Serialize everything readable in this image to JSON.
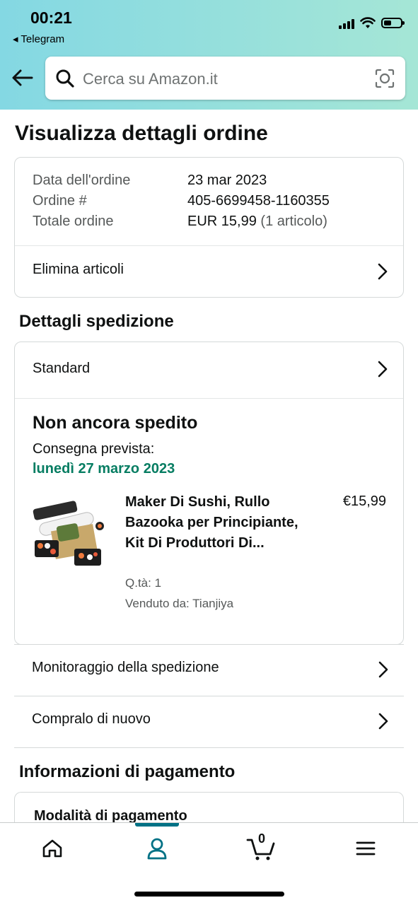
{
  "status_bar": {
    "time": "00:21",
    "back_app": "◂ Telegram"
  },
  "search": {
    "placeholder": "Cerca su Amazon.it"
  },
  "page": {
    "title": "Visualizza dettagli ordine"
  },
  "order_summary": {
    "date_label": "Data dell'ordine",
    "date_value": "23 mar 2023",
    "number_label": "Ordine #",
    "number_value": "405-6699458-1160355",
    "total_label": "Totale ordine",
    "total_value": "EUR 15,99",
    "total_items": "(1 articolo)",
    "delete_items": "Elimina articoli"
  },
  "shipping": {
    "section_title": "Dettagli spedizione",
    "method": "Standard",
    "status": "Non ancora spedito",
    "delivery_label": "Consegna prevista:",
    "delivery_date": "lunedì 27 marzo 2023",
    "product": {
      "name": "Maker Di Sushi, Rullo Bazooka per Principiante, Kit Di Produttori Di...",
      "price": "€15,99",
      "qty": "Q.tà: 1",
      "seller": "Venduto da: Tianjiya"
    }
  },
  "actions": {
    "track": "Monitoraggio della spedizione",
    "buy_again": "Compralo di nuovo"
  },
  "payment": {
    "section_title": "Informazioni di pagamento",
    "method_label": "Modalità di pagamento"
  },
  "tabbar": {
    "cart_count": "0",
    "active_tab": "account"
  },
  "colors": {
    "accent": "#007185",
    "delivery_green": "#067d62",
    "header_gradient_start": "#84d8e3",
    "header_gradient_end": "#a5e6d6"
  },
  "icons": [
    "back-arrow-icon",
    "search-icon",
    "camera-icon",
    "chevron-right-icon",
    "home-icon",
    "user-icon",
    "cart-icon",
    "menu-icon"
  ]
}
